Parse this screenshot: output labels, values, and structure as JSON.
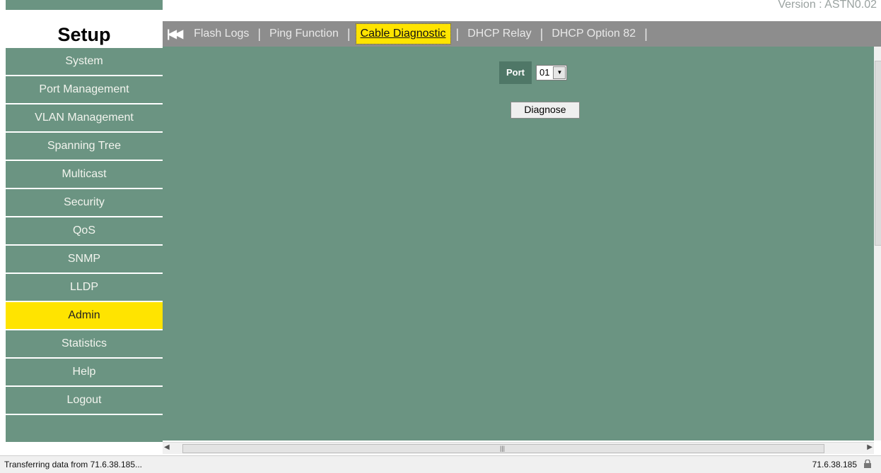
{
  "version_text": "Version : ASTN0.02",
  "sidebar": {
    "header": "Setup",
    "items": [
      {
        "label": "System"
      },
      {
        "label": "Port Management"
      },
      {
        "label": "VLAN Management"
      },
      {
        "label": "Spanning Tree"
      },
      {
        "label": "Multicast"
      },
      {
        "label": "Security"
      },
      {
        "label": "QoS"
      },
      {
        "label": "SNMP"
      },
      {
        "label": "LLDP"
      },
      {
        "label": "Admin"
      },
      {
        "label": "Statistics"
      },
      {
        "label": "Help"
      },
      {
        "label": "Logout"
      }
    ],
    "active_item": "Admin"
  },
  "tabs": {
    "first_icon": "first-page-icon",
    "items": [
      {
        "label": "Flash Logs"
      },
      {
        "label": "Ping Function"
      },
      {
        "label": "Cable Diagnostic"
      },
      {
        "label": "DHCP Relay"
      },
      {
        "label": "DHCP Option 82"
      }
    ],
    "active_tab": "Cable Diagnostic",
    "separator": "|"
  },
  "form": {
    "port_label": "Port",
    "port_value": "01",
    "diagnose_button": "Diagnose"
  },
  "status": {
    "text": "Transferring data from 71.6.38.185...",
    "ip": "71.6.38.185"
  },
  "colors": {
    "panel_green": "#6b9482",
    "highlight_yellow": "#ffe400",
    "tabbar_gray": "#8d8d8d"
  }
}
